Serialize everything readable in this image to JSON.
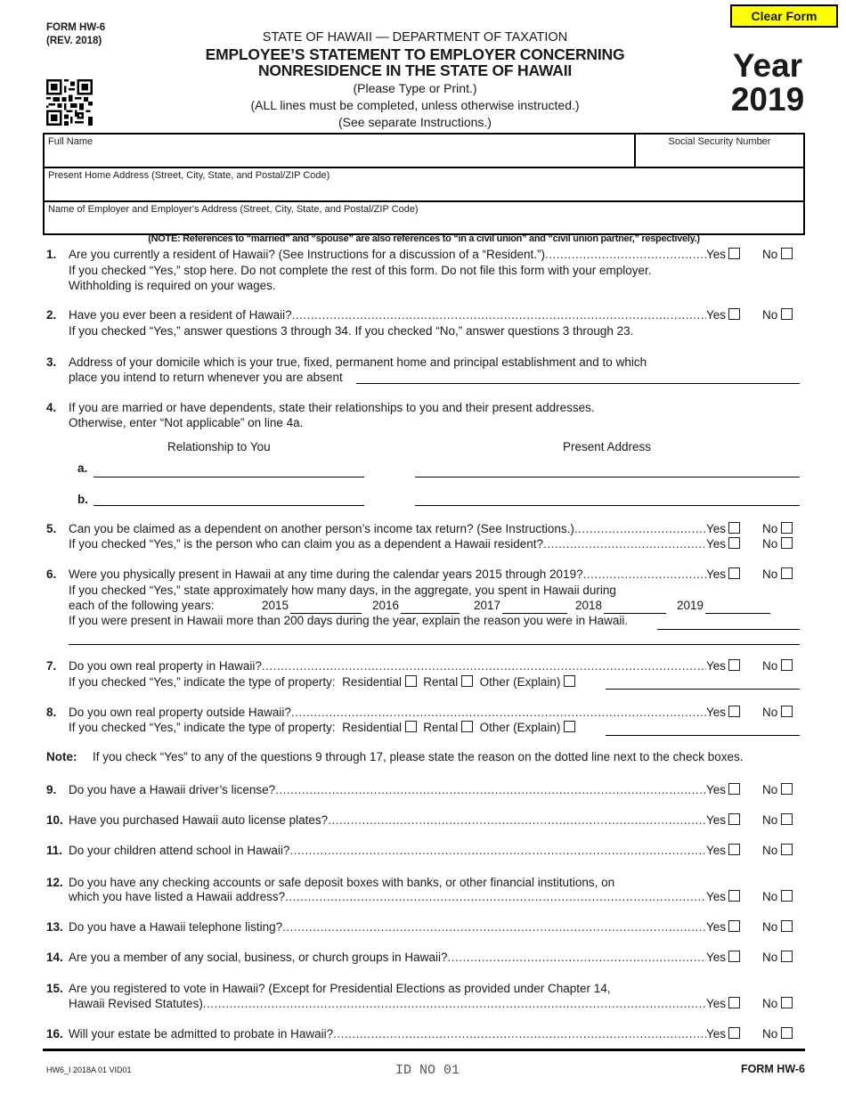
{
  "header": {
    "form_number": "FORM HW-6",
    "revision": "(REV. 2018)",
    "department": "STATE OF HAWAII — DEPARTMENT OF TAXATION",
    "title_line1": "EMPLOYEE’S STATEMENT TO EMPLOYER CONCERNING",
    "title_line2": "NONRESIDENCE IN THE STATE OF HAWAII",
    "instruction1": "(Please Type or Print.)",
    "instruction2": "(ALL lines must be completed, unless otherwise instructed.)",
    "instruction3": "(See separate Instructions.)",
    "clear_button": "Clear Form",
    "year_label": "Year",
    "year_value": "2019",
    "qr_icon": "qr-code-icon"
  },
  "identity": {
    "full_name_label": "Full Name",
    "full_name_value": "",
    "ssn_label": "Social Security Number",
    "ssn_value": "",
    "home_address_label": "Present Home Address (Street, City, State, and Postal/ZIP Code)",
    "home_address_value": "",
    "employer_label": "Name of Employer and Employer's Address (Street, City, State, and Postal/ZIP Code)",
    "employer_value": ""
  },
  "civil_union_note": "(NOTE: References to “married” and “spouse” are also references to “in a civil union” and “civil union partner,” respectively.)",
  "yes_label": "Yes",
  "no_label": "No",
  "questions": {
    "q1": {
      "num": "1.",
      "text": "Are you currently a resident of Hawaii? (See Instructions for a discussion of a “Resident.”)",
      "note1": "If you checked “Yes,” stop here. Do not complete the rest of this form. Do not file this form with your employer.",
      "note2": "Withholding is required on your wages.",
      "answer": null
    },
    "q2": {
      "num": "2.",
      "text": "Have you ever been a resident of Hawaii?",
      "note1": "If you checked “Yes,” answer questions 3 through 34. If you checked “No,” answer questions 3 through 23.",
      "answer": null
    },
    "q3": {
      "num": "3.",
      "text1": "Address of your domicile which is your true, fixed, permanent home and principal establishment and to which",
      "text2": "place you intend to return whenever you are absent",
      "value": ""
    },
    "q4": {
      "num": "4.",
      "text1": "If you are married or have dependents, state their relationships to you and their present addresses.",
      "text2": "Otherwise, enter “Not applicable” on line 4a.",
      "col_relationship": "Relationship to You",
      "col_address": "Present Address",
      "rows": [
        {
          "letter": "a.",
          "relationship": "",
          "address": ""
        },
        {
          "letter": "b.",
          "relationship": "",
          "address": ""
        }
      ]
    },
    "q5": {
      "num": "5.",
      "text": "Can you be claimed as a dependent on another person’s income tax return? (See Instructions.)",
      "text_sub": "If you checked “Yes,” is the person who can claim you as a dependent a Hawaii resident?",
      "answer": null,
      "answer_sub": null
    },
    "q6": {
      "num": "6.",
      "text": "Were you physically present in Hawaii at any time during the calendar years 2015 through 2019?",
      "note1": "If you checked “Yes,” state approximately how many days, in the aggregate, you spent in Hawaii during",
      "note2": "each of the following years:",
      "years": [
        {
          "year": "2015",
          "days": ""
        },
        {
          "year": "2016",
          "days": ""
        },
        {
          "year": "2017",
          "days": ""
        },
        {
          "year": "2018",
          "days": ""
        },
        {
          "year": "2019",
          "days": ""
        }
      ],
      "note3": "If you were present in Hawaii more than 200 days during the year, explain the reason you were in Hawaii.",
      "explanation": "",
      "answer": null
    },
    "q7": {
      "num": "7.",
      "text": "Do you own real property in Hawaii?",
      "type_prompt": "If you checked “Yes,” indicate the type of property:",
      "residential": "Residential",
      "rental": "Rental",
      "other": "Other (Explain)",
      "other_value": "",
      "answer": null
    },
    "q8": {
      "num": "8.",
      "text": "Do you own real property outside Hawaii?",
      "type_prompt": "If you checked “Yes,” indicate the type of property:",
      "residential": "Residential",
      "rental": "Rental",
      "other": "Other (Explain)",
      "other_value": "",
      "answer": null
    },
    "note_9_17": {
      "label": "Note:",
      "text": "If you check “Yes” to any of the questions 9 through 17, please state the reason on the dotted line next to the check boxes."
    },
    "q9": {
      "num": "9.",
      "text": "Do you have a Hawaii driver’s license?",
      "answer": null
    },
    "q10": {
      "num": "10.",
      "text": "Have you purchased Hawaii auto license plates?",
      "answer": null
    },
    "q11": {
      "num": "11.",
      "text": "Do your children attend school in Hawaii?",
      "answer": null
    },
    "q12": {
      "num": "12.",
      "text1": "Do you have any checking accounts or safe deposit boxes with banks, or other financial institutions, on",
      "text2": "which you have listed a Hawaii address?",
      "answer": null
    },
    "q13": {
      "num": "13.",
      "text": "Do you have a Hawaii telephone listing?",
      "answer": null
    },
    "q14": {
      "num": "14.",
      "text": "Are you a member of any social, business, or church groups in Hawaii?",
      "answer": null
    },
    "q15": {
      "num": "15.",
      "text1": "Are you registered to vote in Hawaii? (Except for Presidential Elections as provided under Chapter 14,",
      "text2": "Hawaii Revised Statutes)",
      "answer": null
    },
    "q16": {
      "num": "16.",
      "text": "Will your estate be admitted to probate in Hawaii?",
      "answer": null
    }
  },
  "footer": {
    "code": "HW6_I 2018A 01 VID01",
    "id_number": "ID NO 01",
    "form_label": "FORM HW-6"
  }
}
